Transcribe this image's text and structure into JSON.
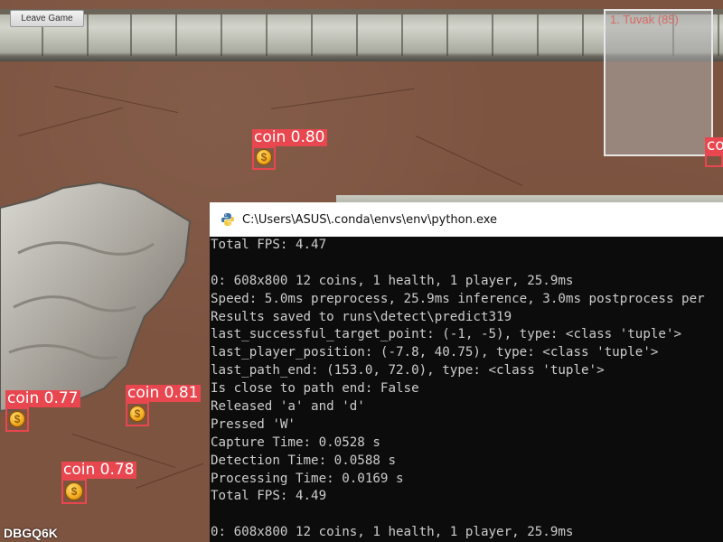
{
  "hud": {
    "leave_button": "Leave Game",
    "room_code": "DBGQ6K"
  },
  "minimap": {
    "label": "1. Tuvak (85)"
  },
  "detections": [
    {
      "label": "coin 0.80"
    },
    {
      "label": "coin 0.77"
    },
    {
      "label": "coin 0.81"
    },
    {
      "label": "coin 0.78"
    },
    {
      "label": "co"
    }
  ],
  "colors": {
    "detection": "#e8474f",
    "ground": "#7d5440",
    "console_bg": "#0c0c0c",
    "console_text": "#cccccc"
  },
  "console": {
    "title": "C:\\Users\\ASUS\\.conda\\envs\\env\\python.exe",
    "lines": [
      "Total FPS: 4.47",
      "",
      "0: 608x800 12 coins, 1 health, 1 player, 25.9ms",
      "Speed: 5.0ms preprocess, 25.9ms inference, 3.0ms postprocess per",
      "Results saved to runs\\detect\\predict319",
      "last_successful_target_point: (-1, -5), type: <class 'tuple'>",
      "last_player_position: (-7.8, 40.75), type: <class 'tuple'>",
      "last_path_end: (153.0, 72.0), type: <class 'tuple'>",
      "Is close to path end: False",
      "Released 'a' and 'd'",
      "Pressed 'W'",
      "Capture Time: 0.0528 s",
      "Detection Time: 0.0588 s",
      "Processing Time: 0.0169 s",
      "Total FPS: 4.49",
      "",
      "0: 608x800 12 coins, 1 health, 1 player, 25.9ms"
    ]
  }
}
